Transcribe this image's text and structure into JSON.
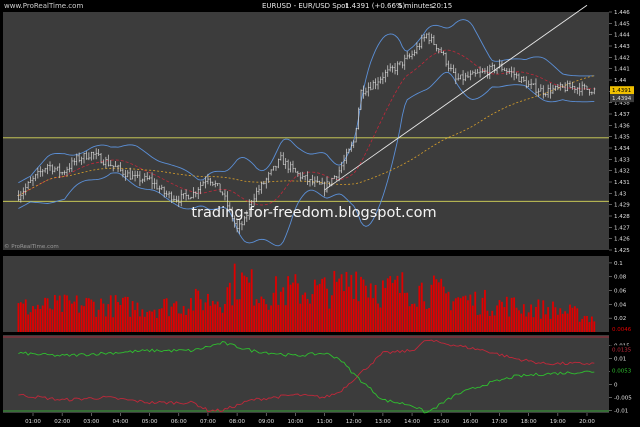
{
  "header": {
    "site": "www.ProRealTime.com",
    "title": "EURUSD - EUR/USD Spot",
    "last": "1.4391 (+0.66%)",
    "period": "5 minutes",
    "time": "20:15"
  },
  "watermark": "trading-for-freedom.blogspot.com",
  "copyright": "© ProRealTime.com",
  "colors": {
    "background": "#000000",
    "panel": "#3c3c3c",
    "price_bars": "#d9d9d9",
    "bollinger": "#5b8fd6",
    "ma_short": "#c0283a",
    "ma_long": "#d9a02a",
    "support_lines": "#d9d95a",
    "trendline": "#e8e8e8",
    "volume": "#e00000",
    "osc_red": "#c0283a",
    "osc_green": "#2fbf2f"
  },
  "chart_data": [
    {
      "type": "candlestick",
      "panel": "price",
      "ylim": [
        1.425,
        1.446
      ],
      "yticks": [
        "1.446",
        "1.445",
        "1.444",
        "1.443",
        "1.442",
        "1.441",
        "1.44",
        "1.439",
        "1.438",
        "1.437",
        "1.436",
        "1.435",
        "1.434",
        "1.433",
        "1.432",
        "1.431",
        "1.43",
        "1.429",
        "1.428",
        "1.427",
        "1.426",
        "1.425"
      ],
      "last_label": "1.4391",
      "band_label": "1.4394",
      "horizontal_lines": [
        1.4349,
        1.4293
      ],
      "trendline": [
        [
          "11:00",
          1.4303
        ],
        [
          "20:00",
          1.4466
        ]
      ],
      "close_profile": [
        [
          "00:30",
          1.4298
        ],
        [
          "01:00",
          1.4312
        ],
        [
          "01:30",
          1.4325
        ],
        [
          "02:00",
          1.4318
        ],
        [
          "02:30",
          1.433
        ],
        [
          "03:00",
          1.4335
        ],
        [
          "03:30",
          1.4328
        ],
        [
          "04:00",
          1.432
        ],
        [
          "04:30",
          1.4313
        ],
        [
          "05:00",
          1.4312
        ],
        [
          "05:30",
          1.43
        ],
        [
          "06:00",
          1.4295
        ],
        [
          "06:30",
          1.43
        ],
        [
          "07:00",
          1.4315
        ],
        [
          "07:30",
          1.43
        ],
        [
          "08:00",
          1.4268
        ],
        [
          "08:15",
          1.4275
        ],
        [
          "08:30",
          1.4295
        ],
        [
          "09:00",
          1.4312
        ],
        [
          "09:30",
          1.433
        ],
        [
          "10:00",
          1.4318
        ],
        [
          "10:30",
          1.431
        ],
        [
          "11:00",
          1.4305
        ],
        [
          "11:30",
          1.432
        ],
        [
          "12:00",
          1.4345
        ],
        [
          "12:15",
          1.439
        ],
        [
          "12:45",
          1.4398
        ],
        [
          "13:00",
          1.4404
        ],
        [
          "13:30",
          1.4412
        ],
        [
          "14:00",
          1.4422
        ],
        [
          "14:30",
          1.444
        ],
        [
          "15:00",
          1.4425
        ],
        [
          "15:30",
          1.44
        ],
        [
          "16:00",
          1.4403
        ],
        [
          "16:30",
          1.4407
        ],
        [
          "17:00",
          1.4412
        ],
        [
          "17:30",
          1.4405
        ],
        [
          "18:00",
          1.4395
        ],
        [
          "18:30",
          1.439
        ],
        [
          "19:00",
          1.4392
        ],
        [
          "19:30",
          1.4394
        ],
        [
          "20:15",
          1.4391
        ]
      ]
    },
    {
      "type": "bar",
      "panel": "volume",
      "ylim": [
        0,
        0.11
      ],
      "yticks": [
        "0.1",
        "0.08",
        "0.06",
        "0.04",
        "0.02"
      ],
      "last_label": "0.0046",
      "profile": [
        [
          "00:30",
          0.035
        ],
        [
          "03:00",
          0.04
        ],
        [
          "05:00",
          0.035
        ],
        [
          "06:00",
          0.04
        ],
        [
          "07:30",
          0.05
        ],
        [
          "08:00",
          0.075
        ],
        [
          "09:00",
          0.055
        ],
        [
          "10:00",
          0.06
        ],
        [
          "11:00",
          0.06
        ],
        [
          "11:40",
          0.065
        ],
        [
          "12:00",
          0.085
        ],
        [
          "13:00",
          0.06
        ],
        [
          "14:00",
          0.065
        ],
        [
          "15:00",
          0.055
        ],
        [
          "16:00",
          0.045
        ],
        [
          "17:00",
          0.04
        ],
        [
          "18:00",
          0.035
        ],
        [
          "19:00",
          0.032
        ],
        [
          "20:15",
          0.02
        ]
      ]
    },
    {
      "type": "line",
      "panel": "oscillator",
      "ylim": [
        -0.011,
        0.019
      ],
      "yticks": [
        "0.015",
        "0.01",
        "0.005",
        "0",
        "-0.005",
        "-0.01"
      ],
      "series": [
        {
          "color": "#c0283a",
          "last_label": "0.0135",
          "values": [
            [
              "00:30",
              -0.004
            ],
            [
              "02:00",
              -0.006
            ],
            [
              "03:30",
              -0.005
            ],
            [
              "05:00",
              -0.007
            ],
            [
              "06:30",
              -0.007
            ],
            [
              "07:00",
              -0.01
            ],
            [
              "07:30",
              -0.01
            ],
            [
              "08:30",
              -0.006
            ],
            [
              "10:00",
              -0.004
            ],
            [
              "11:00",
              -0.005
            ],
            [
              "11:30",
              -0.003
            ],
            [
              "12:00",
              0.002
            ],
            [
              "13:00",
              0.012
            ],
            [
              "14:00",
              0.013
            ],
            [
              "14:30",
              0.017
            ],
            [
              "15:30",
              0.015
            ],
            [
              "16:30",
              0.013
            ],
            [
              "17:30",
              0.01
            ],
            [
              "18:30",
              0.008
            ],
            [
              "20:15",
              0.008
            ]
          ]
        },
        {
          "color": "#2fbf2f",
          "last_label": "0.0053",
          "values": [
            [
              "00:30",
              0.012
            ],
            [
              "02:00",
              0.011
            ],
            [
              "03:30",
              0.012
            ],
            [
              "05:00",
              0.013
            ],
            [
              "06:30",
              0.013
            ],
            [
              "07:30",
              0.016
            ],
            [
              "08:30",
              0.013
            ],
            [
              "10:00",
              0.011
            ],
            [
              "11:00",
              0.012
            ],
            [
              "11:30",
              0.01
            ],
            [
              "12:00",
              0.004
            ],
            [
              "13:00",
              -0.006
            ],
            [
              "14:00",
              -0.008
            ],
            [
              "14:30",
              -0.011
            ],
            [
              "15:30",
              -0.004
            ],
            [
              "16:30",
              0.0
            ],
            [
              "17:30",
              0.003
            ],
            [
              "18:30",
              0.004
            ],
            [
              "20:15",
              0.005
            ]
          ]
        }
      ]
    }
  ],
  "xaxis": {
    "ticks": [
      "01:00",
      "02:00",
      "03:00",
      "04:00",
      "05:00",
      "06:00",
      "07:00",
      "08:00",
      "09:00",
      "10:00",
      "11:00",
      "12:00",
      "13:00",
      "14:00",
      "15:00",
      "16:00",
      "17:00",
      "18:00",
      "19:00",
      "20:00"
    ]
  }
}
